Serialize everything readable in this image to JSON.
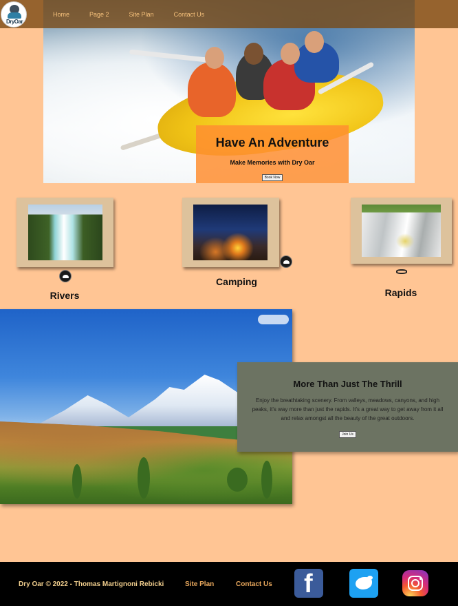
{
  "nav": {
    "logo_text": "DryOar",
    "links": [
      "Home",
      "Page 2",
      "Site Plan",
      "Contact Us"
    ]
  },
  "hero": {
    "title": "Have An Adventure",
    "subtitle": "Make Memories with Dry Oar",
    "button": "Book Now"
  },
  "features": [
    {
      "label": "Rivers",
      "icon": "river-badge-icon"
    },
    {
      "label": "Camping",
      "icon": "tent-badge-icon"
    },
    {
      "label": "Rapids",
      "icon": "raft-icon"
    }
  ],
  "promo": {
    "title": "More Than Just The Thrill",
    "text": "Enjoy the breathtaking scenery. From valleys, meadows, canyons, and high peaks, it's way more than just the rapids. It's a great way to get away from it all and relax amongst all the beauty of the great outdoors.",
    "button": "Join Us"
  },
  "footer": {
    "copyright": "Dry Oar © 2022 - Thomas Martignoni Rebicki",
    "links": [
      "Site Plan",
      "Contact Us"
    ],
    "social": [
      "facebook-icon",
      "twitter-icon",
      "instagram-icon"
    ],
    "facebook_glyph": "f"
  },
  "colors": {
    "page_bg": "#ffc594",
    "nav_bg": "#784812",
    "nav_link": "#f7c27c",
    "hero_card": "#ff8e30",
    "frame": "#ddc29c",
    "promo_bg": "#6c7362",
    "footer_bg": "#000000",
    "footer_text": "#f2cf8e",
    "footer_link": "#e9a85d"
  }
}
